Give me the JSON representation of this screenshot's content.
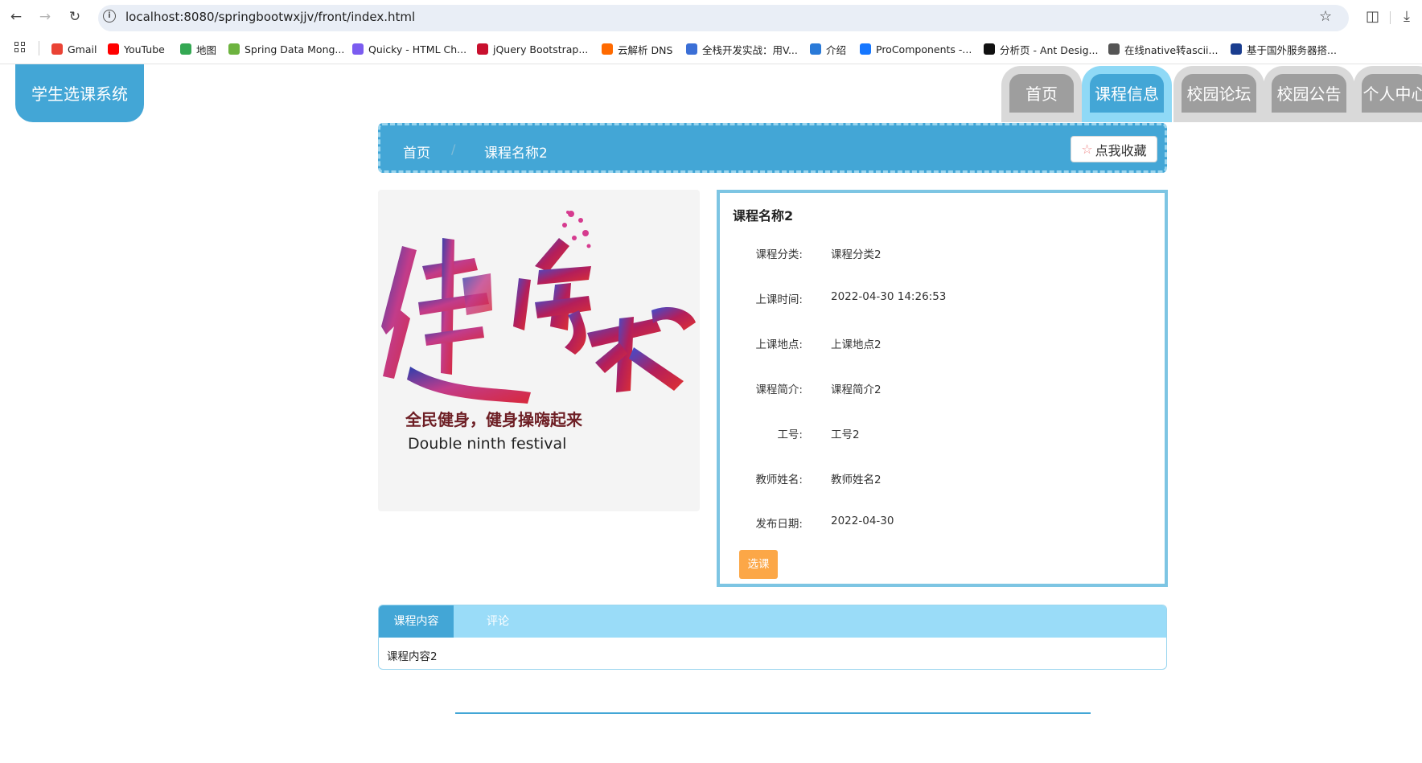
{
  "browser": {
    "url": "localhost:8080/springbootwxjjv/front/index.html",
    "bookmarks": [
      {
        "label": "Gmail",
        "icon": "gmail-icon",
        "color": "#ea4335"
      },
      {
        "label": "YouTube",
        "icon": "youtube-icon",
        "color": "#ff0000"
      },
      {
        "label": "地图",
        "icon": "maps-icon",
        "color": "#34a853"
      },
      {
        "label": "Spring Data Mong...",
        "icon": "spring-icon",
        "color": "#6db33f"
      },
      {
        "label": "Quicky - HTML Ch...",
        "icon": "messenger-icon",
        "color": "#7b5cf0"
      },
      {
        "label": "jQuery Bootstrap...",
        "icon": "jquery-icon",
        "color": "#c8102e"
      },
      {
        "label": "云解析 DNS",
        "icon": "cloud-dns-icon",
        "color": "#ff6a00"
      },
      {
        "label": "全栈开发实战：用V...",
        "icon": "m-icon",
        "color": "#3b6fd6"
      },
      {
        "label": "介绍",
        "icon": "globe-icon",
        "color": "#2a7ad8"
      },
      {
        "label": "ProComponents -...",
        "icon": "antd-icon",
        "color": "#1677ff"
      },
      {
        "label": "分析页 - Ant Desig...",
        "icon": "pro-icon",
        "color": "#111111"
      },
      {
        "label": "在线native转ascii...",
        "icon": "web-icon",
        "color": "#555555"
      },
      {
        "label": "基于国外服务器搭...",
        "icon": "scotland-icon",
        "color": "#1a3d8f"
      }
    ]
  },
  "site": {
    "logo": "学生选课系统",
    "nav": [
      {
        "label": "首页",
        "active": false
      },
      {
        "label": "课程信息",
        "active": true
      },
      {
        "label": "校园论坛",
        "active": false
      },
      {
        "label": "校园公告",
        "active": false
      },
      {
        "label": "个人中心",
        "active": false
      }
    ]
  },
  "breadcrumb": {
    "home": "首页",
    "separator": "/",
    "current": "课程名称2",
    "favorite_label": "点我收藏"
  },
  "course_image": {
    "headline": "全民健身，健身操嗨起来",
    "subtitle": "Double ninth festival"
  },
  "course": {
    "title": "课程名称2",
    "fields": [
      {
        "label": "课程分类:",
        "value": "课程分类2"
      },
      {
        "label": "上课时间:",
        "value": "2022-04-30 14:26:53"
      },
      {
        "label": "上课地点:",
        "value": "上课地点2"
      },
      {
        "label": "课程简介:",
        "value": "课程简介2"
      },
      {
        "label": "工号:",
        "value": "工号2"
      },
      {
        "label": "教师姓名:",
        "value": "教师姓名2"
      },
      {
        "label": "发布日期:",
        "value": "2022-04-30"
      }
    ],
    "select_label": "选课"
  },
  "content_tabs": {
    "tabs": [
      {
        "label": "课程内容",
        "active": true
      },
      {
        "label": "评论",
        "active": false
      }
    ],
    "content": "课程内容2"
  },
  "colors": {
    "primary": "#43a6d6",
    "light": "#9adcf8",
    "accent": "#fca747",
    "inactive_tab": "#9e9e9e"
  }
}
